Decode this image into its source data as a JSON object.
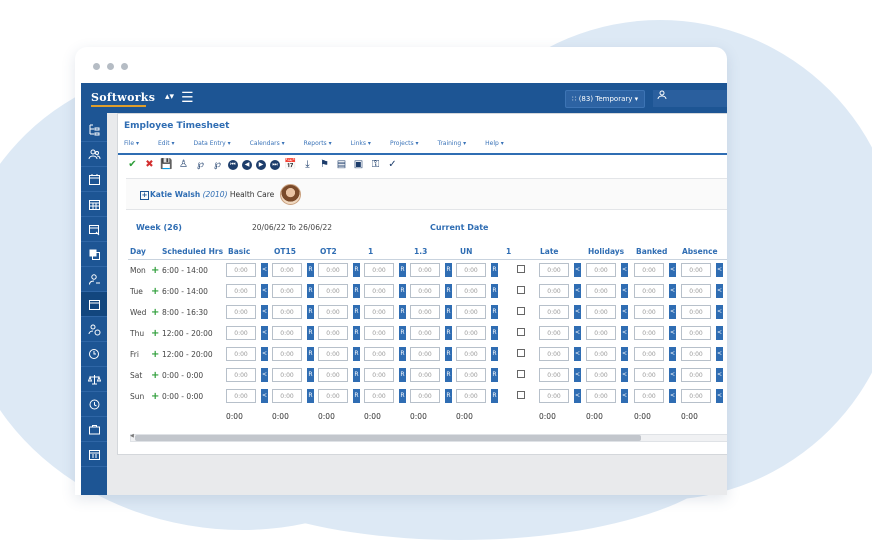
{
  "app": {
    "logo": "Softworks",
    "temp_label": "(83) Temporary ▾",
    "user_icon": "user-icon"
  },
  "page": {
    "title": "Employee Timesheet",
    "menu": [
      "File ▾",
      "Edit ▾",
      "Data Entry ▾",
      "Calendars ▾",
      "Reports ▾",
      "Links ▾",
      "Projects ▾",
      "Training ▾",
      "Help ▾"
    ]
  },
  "employee": {
    "name": "Katie Walsh",
    "code": "(2010)",
    "dept": "Health Care"
  },
  "week": {
    "label": "Week (26)",
    "range": "20/06/22 To 26/06/22",
    "current_date": "Current Date"
  },
  "columns": [
    "Day",
    "Scheduled Hrs",
    "Basic",
    "OT15",
    "OT2",
    "1",
    "1.3",
    "UN",
    "1",
    "Late",
    "Holidays",
    "Banked",
    "Absence"
  ],
  "rows": [
    {
      "day": "Mon",
      "sched": "6:00 - 14:00"
    },
    {
      "day": "Tue",
      "sched": "6:00 - 14:00"
    },
    {
      "day": "Wed",
      "sched": "8:00 - 16:30"
    },
    {
      "day": "Thu",
      "sched": "12:00 - 20:00"
    },
    {
      "day": "Fri",
      "sched": "12:00 - 20:00"
    },
    {
      "day": "Sat",
      "sched": "0:00 - 0:00"
    },
    {
      "day": "Sun",
      "sched": "0:00 - 0:00"
    }
  ],
  "cell_value": "0:00",
  "btn_left": "<",
  "btn_r": "R",
  "totals": [
    "0:00",
    "0:00",
    "0:00",
    "0:00",
    "0:00",
    "0:00",
    "0:00",
    "0:00",
    "0:00",
    "0:00"
  ],
  "colors": {
    "brand": "#1d5594",
    "accent": "#2f6db3",
    "ok": "#2e9e3a",
    "cancel": "#d32f2f"
  }
}
